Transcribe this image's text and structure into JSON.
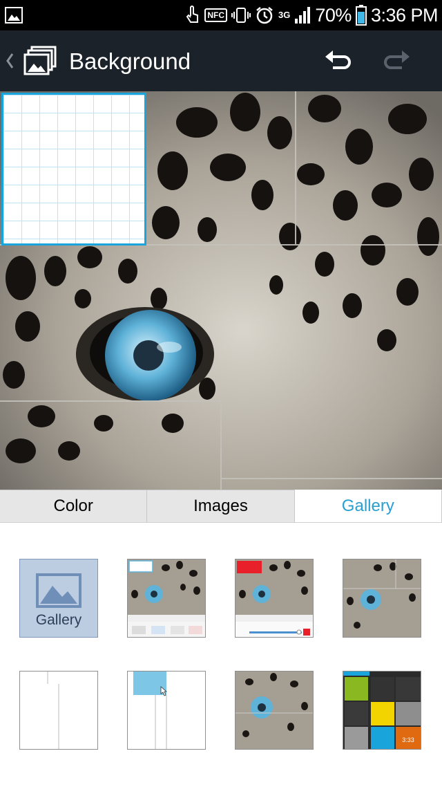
{
  "status_bar": {
    "nfc_label": "NFC",
    "network_label": "3G",
    "battery_percent": "70%",
    "time": "3:36 PM"
  },
  "action_bar": {
    "title": "Background",
    "icons": [
      "back-chevron-icon",
      "gallery-stack-icon",
      "undo-icon",
      "redo-icon"
    ]
  },
  "tabs": [
    {
      "label": "Color",
      "active": false
    },
    {
      "label": "Images",
      "active": false
    },
    {
      "label": "Gallery",
      "active": true
    }
  ],
  "gallery_tile": {
    "label": "Gallery"
  },
  "thumb_texts": {
    "clock": "3:33"
  },
  "colors": {
    "accent": "#2a9fd0",
    "selection_border": "#1aa4dc",
    "actionbar_bg": "#1c222a"
  }
}
